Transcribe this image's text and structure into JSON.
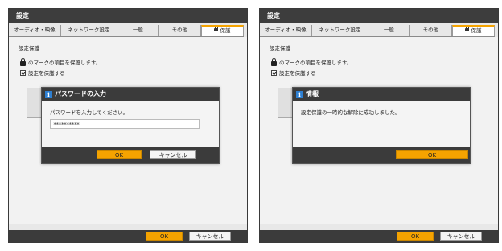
{
  "colors": {
    "accent": "#f5a300",
    "titlebar": "#3d3d3d",
    "info": "#2e7fd1"
  },
  "windows": [
    {
      "title": "設定",
      "tabs": [
        "オーディオ・映像",
        "ネットワーク設定",
        "一般",
        "その他",
        "保護"
      ],
      "section_title": "設定保護",
      "lock_text": "のマークの項目を保護します。",
      "checkbox_label": "設定を保護する",
      "dialog": {
        "icon": "i",
        "title": "パスワードの入力",
        "message": "パスワードを入力してください。",
        "password_value": "**********",
        "ok": "OK",
        "cancel": "キャンセル"
      },
      "ok": "OK",
      "cancel": "キャンセル"
    },
    {
      "title": "設定",
      "tabs": [
        "オーディオ・映像",
        "ネットワーク設定",
        "一般",
        "その他",
        "保護"
      ],
      "section_title": "設定保護",
      "lock_text": "のマークの項目を保護します。",
      "checkbox_label": "設定を保護する",
      "dialog": {
        "icon": "i",
        "title": "情報",
        "message": "設定保護の一時的な解除に成功しました。",
        "ok": "OK"
      },
      "ok": "OK",
      "cancel": "キャンセル"
    }
  ]
}
